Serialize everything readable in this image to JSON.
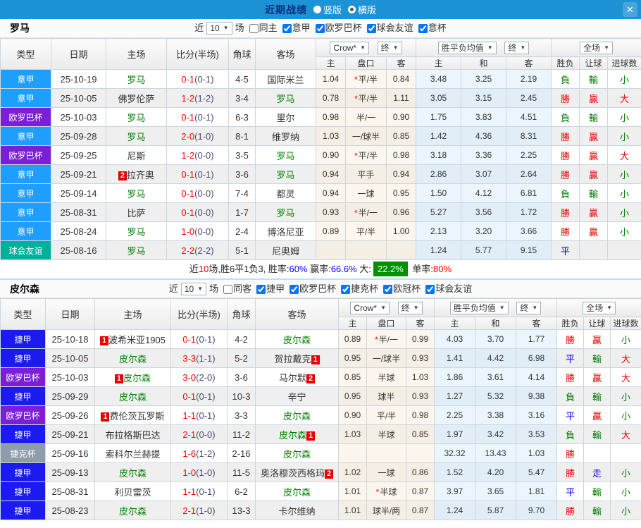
{
  "ui": {
    "caret": "▼",
    "close": "✕"
  },
  "topbar": {
    "title": "近期战绩",
    "vertical": "竖版",
    "horizontal": "横版"
  },
  "table_header": {
    "cols": [
      "类型",
      "日期",
      "主场",
      "比分(半场)",
      "角球",
      "客场"
    ],
    "dd_company": "Crow*",
    "dd_final": "终",
    "dd_avg": "胜平负均值",
    "dd_final2": "终",
    "dd_full": "全场",
    "sub": [
      "主",
      "盘口",
      "客",
      "主",
      "和",
      "客",
      "胜负",
      "让球",
      "进球数"
    ]
  },
  "league_colors": {
    "意甲": "#1e9fff",
    "欧罗巴杯": "#7a1fd6",
    "球会友谊": "#00b09b",
    "捷甲": "#1b1bf0",
    "捷克杯": "#8e9cab"
  },
  "result_colors": {
    "勝": "red",
    "贏": "red",
    "大": "red",
    "負": "green",
    "輸": "green",
    "小": "green",
    "平": "blue",
    "走": "blue"
  },
  "sections": [
    {
      "team": "罗马",
      "filter": {
        "near": "近",
        "count": "10",
        "games": "场",
        "same": {
          "label": "同主",
          "checked": false
        },
        "comps": [
          {
            "label": "意甲",
            "checked": true
          },
          {
            "label": "欧罗巴杯",
            "checked": true
          },
          {
            "label": "球会友谊",
            "checked": true
          },
          {
            "label": "意杯",
            "checked": true
          }
        ]
      },
      "rows": [
        {
          "league": "意甲",
          "date": "25-10-19",
          "home": "罗马",
          "home_self": true,
          "home_badge": "",
          "score": "0-1",
          "half": "(0-1)",
          "corner": "4-5",
          "away": "国际米兰",
          "away_self": false,
          "away_badge": "",
          "odds_home": "1.04",
          "handicap": "平/半",
          "handicap_star": true,
          "odds_away": "0.84",
          "avg_home": "3.48",
          "avg_draw": "3.25",
          "avg_away": "2.19",
          "res_wdl": "負",
          "res_handicap": "輸",
          "res_goals": "小"
        },
        {
          "league": "意甲",
          "date": "25-10-05",
          "home": "佛罗伦萨",
          "home_self": false,
          "home_badge": "",
          "score": "1-2",
          "half": "(1-2)",
          "corner": "3-4",
          "away": "罗马",
          "away_self": true,
          "away_badge": "",
          "odds_home": "0.78",
          "handicap": "平/半",
          "handicap_star": true,
          "odds_away": "1.11",
          "avg_home": "3.05",
          "avg_draw": "3.15",
          "avg_away": "2.45",
          "res_wdl": "勝",
          "res_handicap": "贏",
          "res_goals": "大"
        },
        {
          "league": "欧罗巴杯",
          "date": "25-10-03",
          "home": "罗马",
          "home_self": true,
          "home_badge": "",
          "score": "0-1",
          "half": "(0-1)",
          "corner": "6-3",
          "away": "里尔",
          "away_self": false,
          "away_badge": "",
          "odds_home": "0.98",
          "handicap": "半/一",
          "handicap_star": false,
          "odds_away": "0.90",
          "avg_home": "1.75",
          "avg_draw": "3.83",
          "avg_away": "4.51",
          "res_wdl": "負",
          "res_handicap": "輸",
          "res_goals": "小"
        },
        {
          "league": "意甲",
          "date": "25-09-28",
          "home": "罗马",
          "home_self": true,
          "home_badge": "",
          "score": "2-0",
          "half": "(1-0)",
          "corner": "8-1",
          "away": "维罗纳",
          "away_self": false,
          "away_badge": "",
          "odds_home": "1.03",
          "handicap": "一/球半",
          "handicap_star": false,
          "odds_away": "0.85",
          "avg_home": "1.42",
          "avg_draw": "4.36",
          "avg_away": "8.31",
          "res_wdl": "勝",
          "res_handicap": "贏",
          "res_goals": "小"
        },
        {
          "league": "欧罗巴杯",
          "date": "25-09-25",
          "home": "尼斯",
          "home_self": false,
          "home_badge": "",
          "score": "1-2",
          "half": "(0-0)",
          "corner": "3-5",
          "away": "罗马",
          "away_self": true,
          "away_badge": "",
          "odds_home": "0.90",
          "handicap": "平/半",
          "handicap_star": true,
          "odds_away": "0.98",
          "avg_home": "3.18",
          "avg_draw": "3.36",
          "avg_away": "2.25",
          "res_wdl": "勝",
          "res_handicap": "贏",
          "res_goals": "大"
        },
        {
          "league": "意甲",
          "date": "25-09-21",
          "home": "拉齐奥",
          "home_self": false,
          "home_badge": "2",
          "score": "0-1",
          "half": "(0-1)",
          "corner": "3-6",
          "away": "罗马",
          "away_self": true,
          "away_badge": "",
          "odds_home": "0.94",
          "handicap": "平手",
          "handicap_star": false,
          "odds_away": "0.94",
          "avg_home": "2.86",
          "avg_draw": "3.07",
          "avg_away": "2.64",
          "res_wdl": "勝",
          "res_handicap": "贏",
          "res_goals": "小"
        },
        {
          "league": "意甲",
          "date": "25-09-14",
          "home": "罗马",
          "home_self": true,
          "home_badge": "",
          "score": "0-1",
          "half": "(0-0)",
          "corner": "7-4",
          "away": "都灵",
          "away_self": false,
          "away_badge": "",
          "odds_home": "0.94",
          "handicap": "一球",
          "handicap_star": false,
          "odds_away": "0.95",
          "avg_home": "1.50",
          "avg_draw": "4.12",
          "avg_away": "6.81",
          "res_wdl": "負",
          "res_handicap": "輸",
          "res_goals": "小"
        },
        {
          "league": "意甲",
          "date": "25-08-31",
          "home": "比萨",
          "home_self": false,
          "home_badge": "",
          "score": "0-1",
          "half": "(0-0)",
          "corner": "1-7",
          "away": "罗马",
          "away_self": true,
          "away_badge": "",
          "odds_home": "0.93",
          "handicap": "半/一",
          "handicap_star": true,
          "odds_away": "0.96",
          "avg_home": "5.27",
          "avg_draw": "3.56",
          "avg_away": "1.72",
          "res_wdl": "勝",
          "res_handicap": "贏",
          "res_goals": "小"
        },
        {
          "league": "意甲",
          "date": "25-08-24",
          "home": "罗马",
          "home_self": true,
          "home_badge": "",
          "score": "1-0",
          "half": "(0-0)",
          "corner": "2-4",
          "away": "博洛尼亚",
          "away_self": false,
          "away_badge": "",
          "odds_home": "0.89",
          "handicap": "平/半",
          "handicap_star": false,
          "odds_away": "1.00",
          "avg_home": "2.13",
          "avg_draw": "3.20",
          "avg_away": "3.66",
          "res_wdl": "勝",
          "res_handicap": "贏",
          "res_goals": "小"
        },
        {
          "league": "球会友谊",
          "date": "25-08-16",
          "home": "罗马",
          "home_self": true,
          "home_badge": "",
          "score": "2-2",
          "half": "(2-2)",
          "corner": "5-1",
          "away": "尼奥姆",
          "away_self": false,
          "away_badge": "",
          "odds_home": "",
          "handicap": "",
          "handicap_star": false,
          "odds_away": "",
          "avg_home": "1.24",
          "avg_draw": "5.77",
          "avg_away": "9.15",
          "res_wdl": "平",
          "res_handicap": "",
          "res_goals": ""
        }
      ],
      "summary": [
        {
          "t": "近",
          "s": "plain"
        },
        {
          "t": "10",
          "s": "red"
        },
        {
          "t": "场,胜6平1负3, 胜率:",
          "s": "plain"
        },
        {
          "t": "60%",
          "s": "blue"
        },
        {
          "t": " 赢率:",
          "s": "plain"
        },
        {
          "t": "66.6%",
          "s": "blue"
        },
        {
          "t": " 大:",
          "s": "plain"
        },
        {
          "t": "22.2%",
          "s": "greenbadge"
        },
        {
          "t": " 单率:",
          "s": "plain"
        },
        {
          "t": "80%",
          "s": "red"
        }
      ]
    },
    {
      "team": "皮尔森",
      "filter": {
        "near": "近",
        "count": "10",
        "games": "场",
        "same": {
          "label": "同客",
          "checked": false
        },
        "comps": [
          {
            "label": "捷甲",
            "checked": true
          },
          {
            "label": "欧罗巴杯",
            "checked": true
          },
          {
            "label": "捷克杯",
            "checked": true
          },
          {
            "label": "欧冠杯",
            "checked": true
          },
          {
            "label": "球会友谊",
            "checked": true
          }
        ]
      },
      "rows": [
        {
          "league": "捷甲",
          "date": "25-10-18",
          "home": "波希米亚1905",
          "home_self": false,
          "home_badge": "1",
          "score": "0-1",
          "half": "(0-1)",
          "corner": "4-2",
          "away": "皮尔森",
          "away_self": true,
          "away_badge": "",
          "odds_home": "0.89",
          "handicap": "半/一",
          "handicap_star": true,
          "odds_away": "0.99",
          "avg_home": "4.03",
          "avg_draw": "3.70",
          "avg_away": "1.77",
          "res_wdl": "勝",
          "res_handicap": "贏",
          "res_goals": "小"
        },
        {
          "league": "捷甲",
          "date": "25-10-05",
          "home": "皮尔森",
          "home_self": true,
          "home_badge": "",
          "score": "3-3",
          "half": "(1-1)",
          "corner": "5-2",
          "away": "贺拉戴克",
          "away_self": false,
          "away_badge": "1",
          "odds_home": "0.95",
          "handicap": "一/球半",
          "handicap_star": false,
          "odds_away": "0.93",
          "avg_home": "1.41",
          "avg_draw": "4.42",
          "avg_away": "6.98",
          "res_wdl": "平",
          "res_handicap": "輸",
          "res_goals": "大"
        },
        {
          "league": "欧罗巴杯",
          "date": "25-10-03",
          "home": "皮尔森",
          "home_self": true,
          "home_badge": "1",
          "score": "3-0",
          "half": "(2-0)",
          "corner": "3-6",
          "away": "马尔默",
          "away_self": false,
          "away_badge": "2",
          "odds_home": "0.85",
          "handicap": "半球",
          "handicap_star": false,
          "odds_away": "1.03",
          "avg_home": "1.86",
          "avg_draw": "3.61",
          "avg_away": "4.14",
          "res_wdl": "勝",
          "res_handicap": "贏",
          "res_goals": "大"
        },
        {
          "league": "捷甲",
          "date": "25-09-29",
          "home": "皮尔森",
          "home_self": true,
          "home_badge": "",
          "score": "0-1",
          "half": "(0-1)",
          "corner": "10-3",
          "away": "辛宁",
          "away_self": false,
          "away_badge": "",
          "odds_home": "0.95",
          "handicap": "球半",
          "handicap_star": false,
          "odds_away": "0.93",
          "avg_home": "1.27",
          "avg_draw": "5.32",
          "avg_away": "9.38",
          "res_wdl": "負",
          "res_handicap": "輸",
          "res_goals": "小"
        },
        {
          "league": "欧罗巴杯",
          "date": "25-09-26",
          "home": "费伦茨瓦罗斯",
          "home_self": false,
          "home_badge": "1",
          "score": "1-1",
          "half": "(0-1)",
          "corner": "3-3",
          "away": "皮尔森",
          "away_self": true,
          "away_badge": "",
          "odds_home": "0.90",
          "handicap": "平/半",
          "handicap_star": false,
          "odds_away": "0.98",
          "avg_home": "2.25",
          "avg_draw": "3.38",
          "avg_away": "3.16",
          "res_wdl": "平",
          "res_handicap": "贏",
          "res_goals": "小"
        },
        {
          "league": "捷甲",
          "date": "25-09-21",
          "home": "布拉格斯巴达",
          "home_self": false,
          "home_badge": "",
          "score": "2-1",
          "half": "(0-0)",
          "corner": "11-2",
          "away": "皮尔森",
          "away_self": true,
          "away_badge": "1",
          "odds_home": "1.03",
          "handicap": "半球",
          "handicap_star": false,
          "odds_away": "0.85",
          "avg_home": "1.97",
          "avg_draw": "3.42",
          "avg_away": "3.53",
          "res_wdl": "負",
          "res_handicap": "輸",
          "res_goals": "大"
        },
        {
          "league": "捷克杯",
          "date": "25-09-16",
          "home": "索科尔兰赫提",
          "home_self": false,
          "home_badge": "",
          "score": "1-6",
          "half": "(1-2)",
          "corner": "2-16",
          "away": "皮尔森",
          "away_self": true,
          "away_badge": "",
          "odds_home": "",
          "handicap": "",
          "handicap_star": false,
          "odds_away": "",
          "avg_home": "32.32",
          "avg_draw": "13.43",
          "avg_away": "1.03",
          "res_wdl": "勝",
          "res_handicap": "",
          "res_goals": ""
        },
        {
          "league": "捷甲",
          "date": "25-09-13",
          "home": "皮尔森",
          "home_self": true,
          "home_badge": "",
          "score": "1-0",
          "half": "(1-0)",
          "corner": "11-5",
          "away": "奥洛穆茨西格玛",
          "away_self": false,
          "away_badge": "2",
          "odds_home": "1.02",
          "handicap": "一球",
          "handicap_star": false,
          "odds_away": "0.86",
          "avg_home": "1.52",
          "avg_draw": "4.20",
          "avg_away": "5.47",
          "res_wdl": "勝",
          "res_handicap": "走",
          "res_goals": "小"
        },
        {
          "league": "捷甲",
          "date": "25-08-31",
          "home": "利贝雷茨",
          "home_self": false,
          "home_badge": "",
          "score": "1-1",
          "half": "(0-1)",
          "corner": "6-2",
          "away": "皮尔森",
          "away_self": true,
          "away_badge": "",
          "odds_home": "1.01",
          "handicap": "半球",
          "handicap_star": true,
          "odds_away": "0.87",
          "avg_home": "3.97",
          "avg_draw": "3.65",
          "avg_away": "1.81",
          "res_wdl": "平",
          "res_handicap": "輸",
          "res_goals": "小"
        },
        {
          "league": "捷甲",
          "date": "25-08-23",
          "home": "皮尔森",
          "home_self": true,
          "home_badge": "",
          "score": "2-1",
          "half": "(1-0)",
          "corner": "13-3",
          "away": "卡尔维纳",
          "away_self": false,
          "away_badge": "",
          "odds_home": "1.01",
          "handicap": "球半/两",
          "handicap_star": false,
          "odds_away": "0.87",
          "avg_home": "1.24",
          "avg_draw": "5.87",
          "avg_away": "9.70",
          "res_wdl": "勝",
          "res_handicap": "輸",
          "res_goals": "小"
        }
      ],
      "summary": null
    }
  ]
}
